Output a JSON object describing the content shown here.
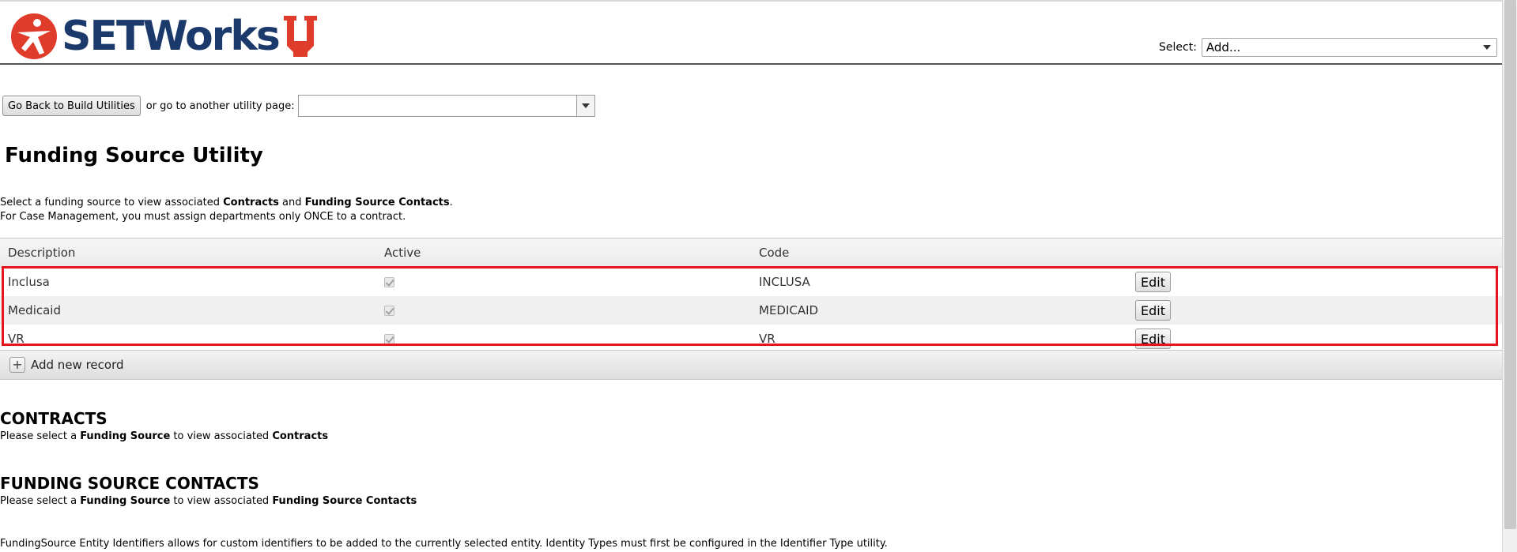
{
  "header": {
    "logo_text": "SETWorks",
    "select_label": "Select:",
    "select_value": "Add..."
  },
  "nav": {
    "back_button": "Go Back to Build Utilities",
    "text": "or go to another utility page:",
    "utility_select_value": ""
  },
  "page_title": "Funding Source Utility",
  "intro": {
    "line1_prefix": "Select a funding source to view associated ",
    "line1_bold1": "Contracts",
    "line1_mid": " and ",
    "line1_bold2": "Funding Source Contacts",
    "line1_suffix": ".",
    "line2": "For Case Management, you must assign departments only ONCE to a contract."
  },
  "grid": {
    "columns": [
      "Description",
      "Active",
      "Code",
      ""
    ],
    "rows": [
      {
        "description": "Inclusa",
        "active": true,
        "code": "INCLUSA",
        "action": "Edit"
      },
      {
        "description": "Medicaid",
        "active": true,
        "code": "MEDICAID",
        "action": "Edit"
      },
      {
        "description": "VR",
        "active": true,
        "code": "VR",
        "action": "Edit"
      }
    ],
    "add_label": "Add new record",
    "add_icon": "+"
  },
  "contracts": {
    "heading": "CONTRACTS",
    "prefix": "Please select a ",
    "bold1": "Funding Source",
    "mid": " to view associated ",
    "bold2": "Contracts"
  },
  "contacts": {
    "heading": "FUNDING SOURCE CONTACTS",
    "prefix": "Please select a ",
    "bold1": "Funding Source",
    "mid": " to view associated ",
    "bold2": "Funding Source Contacts"
  },
  "footer_note": "FundingSource Entity Identifiers allows for custom identifiers to be added to the currently selected entity. Identity Types must first be configured in the Identifier Type utility.",
  "colors": {
    "brand_navy": "#1b3a6b",
    "brand_red": "#e03c2b",
    "highlight_red": "#e8141b"
  }
}
